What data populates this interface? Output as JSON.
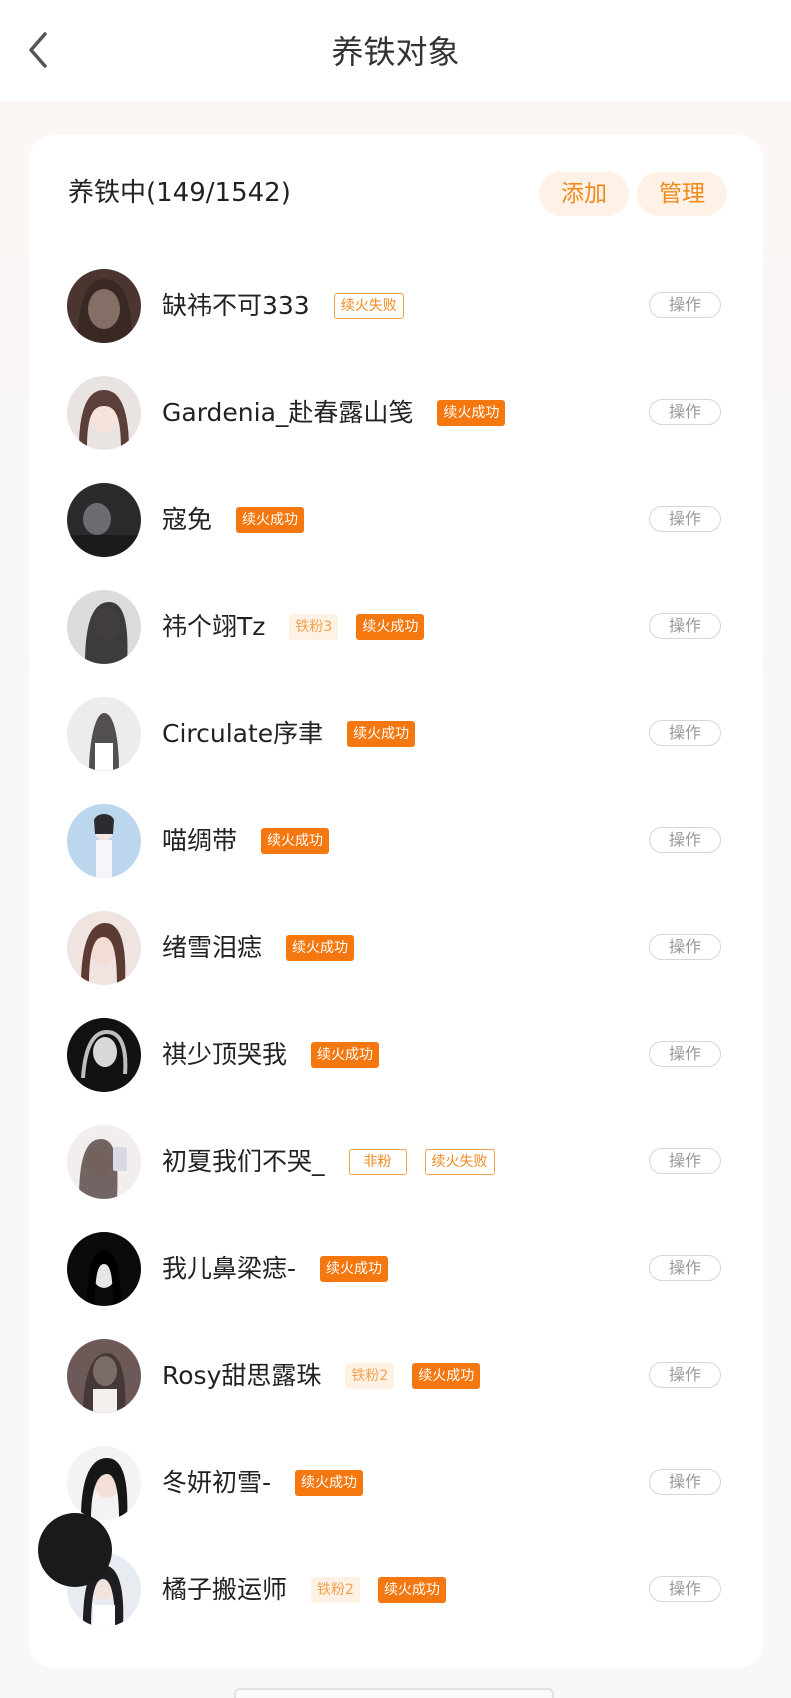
{
  "header": {
    "title": "养铁对象",
    "back_icon": "chevron-left-icon"
  },
  "section": {
    "title": "养铁中(149/1542)",
    "add_label": "添加",
    "manage_label": "管理"
  },
  "colors": {
    "accent": "#f5770f",
    "pill_bg": "#fff1e5",
    "op_border": "#d6d6d6"
  },
  "items": [
    {
      "name": "缺祎不可333",
      "tags": [
        {
          "text": "续火失败",
          "style": "fail"
        }
      ],
      "op": "操作"
    },
    {
      "name": "Gardenia_赴春露山笺",
      "tags": [
        {
          "text": "续火成功",
          "style": "success"
        }
      ],
      "op": "操作"
    },
    {
      "name": "寇免",
      "tags": [
        {
          "text": "续火成功",
          "style": "success"
        }
      ],
      "op": "操作"
    },
    {
      "name": "祎个翊Tz",
      "tags": [
        {
          "text": "铁粉3",
          "style": "fan"
        },
        {
          "text": "续火成功",
          "style": "success"
        }
      ],
      "op": "操作"
    },
    {
      "name": "Circulate序聿",
      "tags": [
        {
          "text": "续火成功",
          "style": "success"
        }
      ],
      "op": "操作"
    },
    {
      "name": "喵绸带",
      "tags": [
        {
          "text": "续火成功",
          "style": "success"
        }
      ],
      "op": "操作"
    },
    {
      "name": "绪雪泪痣",
      "tags": [
        {
          "text": "续火成功",
          "style": "success"
        }
      ],
      "op": "操作"
    },
    {
      "name": "祺少顶哭我",
      "tags": [
        {
          "text": "续火成功",
          "style": "success"
        }
      ],
      "op": "操作"
    },
    {
      "name": "初夏我们不哭_",
      "tags": [
        {
          "text": "非粉",
          "style": "nonfan"
        },
        {
          "text": "续火失败",
          "style": "fail"
        }
      ],
      "op": "操作"
    },
    {
      "name": "我儿鼻梁痣-",
      "tags": [
        {
          "text": "续火成功",
          "style": "success"
        }
      ],
      "op": "操作"
    },
    {
      "name": "Rosy甜思露珠",
      "tags": [
        {
          "text": "铁粉2",
          "style": "fan"
        },
        {
          "text": "续火成功",
          "style": "success"
        }
      ],
      "op": "操作"
    },
    {
      "name": "冬妍初雪-",
      "tags": [
        {
          "text": "续火成功",
          "style": "success"
        }
      ],
      "op": "操作"
    },
    {
      "name": "橘子搬运师",
      "tags": [
        {
          "text": "铁粉2",
          "style": "fan"
        },
        {
          "text": "续火成功",
          "style": "success"
        }
      ],
      "op": "操作"
    }
  ]
}
